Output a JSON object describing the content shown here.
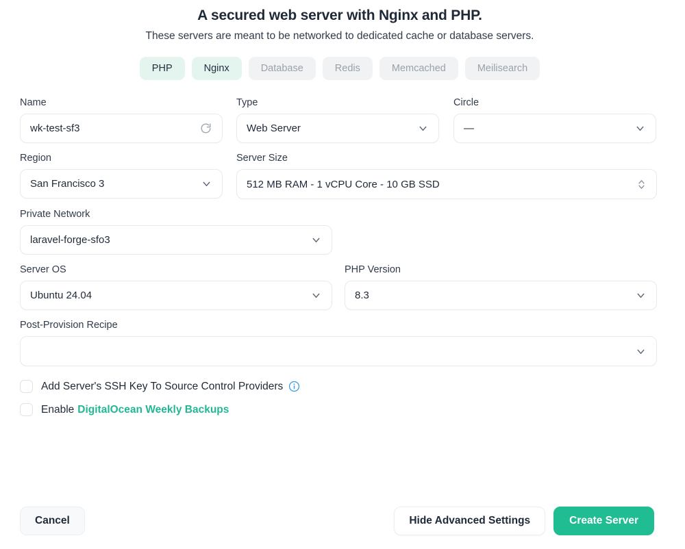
{
  "modal": {
    "title": "A secured web server with Nginx and PHP.",
    "subtitle": "These servers are meant to be networked to dedicated cache or database servers."
  },
  "tags": [
    {
      "label": "PHP",
      "active": true
    },
    {
      "label": "Nginx",
      "active": true
    },
    {
      "label": "Database",
      "active": false
    },
    {
      "label": "Redis",
      "active": false
    },
    {
      "label": "Memcached",
      "active": false
    },
    {
      "label": "Meilisearch",
      "active": false
    }
  ],
  "fields": {
    "name": {
      "label": "Name",
      "value": "wk-test-sf3",
      "icon": "refresh-icon"
    },
    "type": {
      "label": "Type",
      "value": "Web Server",
      "icon": "chevron-down-icon"
    },
    "circle": {
      "label": "Circle",
      "value": "—",
      "icon": "chevron-down-icon"
    },
    "region": {
      "label": "Region",
      "value": "San Francisco 3",
      "icon": "chevron-down-icon"
    },
    "server_size": {
      "label": "Server Size",
      "value": "512 MB RAM - 1 vCPU Core - 10 GB SSD",
      "icon": "stepper-updown-icon"
    },
    "private_network": {
      "label": "Private Network",
      "value": "laravel-forge-sfo3",
      "icon": "chevron-down-icon"
    },
    "server_os": {
      "label": "Server OS",
      "value": "Ubuntu 24.04",
      "icon": "chevron-down-icon"
    },
    "php_version": {
      "label": "PHP Version",
      "value": "8.3",
      "icon": "chevron-down-icon"
    },
    "post_provision_recipe": {
      "label": "Post-Provision Recipe",
      "value": "",
      "icon": "chevron-down-icon"
    }
  },
  "checkboxes": [
    {
      "label": "Add Server's SSH Key To Source Control Providers",
      "checked": false,
      "info": true,
      "link": ""
    },
    {
      "label": "Enable",
      "checked": false,
      "info": false,
      "link": "DigitalOcean Weekly Backups"
    }
  ],
  "footer": {
    "cancel": "Cancel",
    "advanced": "Hide Advanced Settings",
    "create": "Create Server"
  },
  "colors": {
    "accent": "#20bd92",
    "tag_active_bg": "#e4f4ef",
    "tag_bg": "#f1f2f4",
    "info_blue": "#3b9ae1",
    "text": "#1f2937"
  }
}
